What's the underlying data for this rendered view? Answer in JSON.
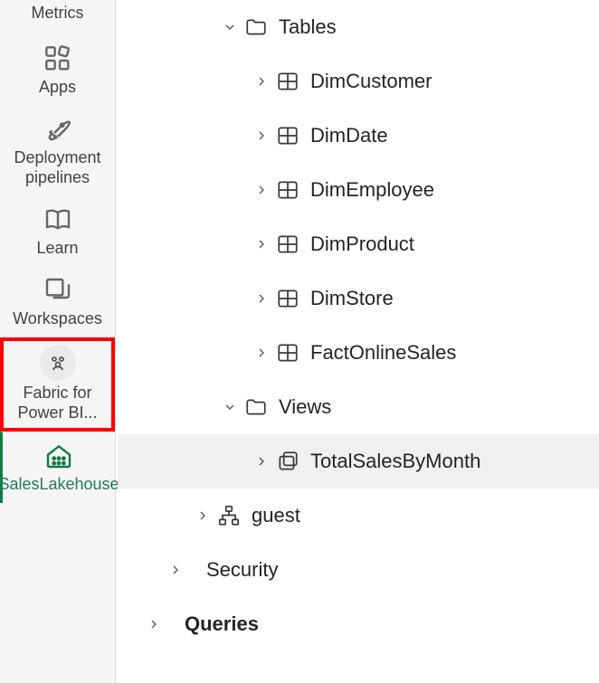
{
  "nav": {
    "metrics_label": "Metrics",
    "items": [
      {
        "label": "Apps"
      },
      {
        "label": "Deployment pipelines"
      },
      {
        "label": "Learn"
      },
      {
        "label": "Workspaces"
      },
      {
        "label": "Fabric for Power BI..."
      },
      {
        "label": "SalesLakehouse"
      }
    ]
  },
  "tree": {
    "tables": {
      "label": "Tables",
      "items": [
        "DimCustomer",
        "DimDate",
        "DimEmployee",
        "DimProduct",
        "DimStore",
        "FactOnlineSales"
      ]
    },
    "views": {
      "label": "Views",
      "items": [
        "TotalSalesByMonth"
      ]
    },
    "schemas": {
      "guest": "guest"
    },
    "security": "Security",
    "queries": "Queries"
  }
}
